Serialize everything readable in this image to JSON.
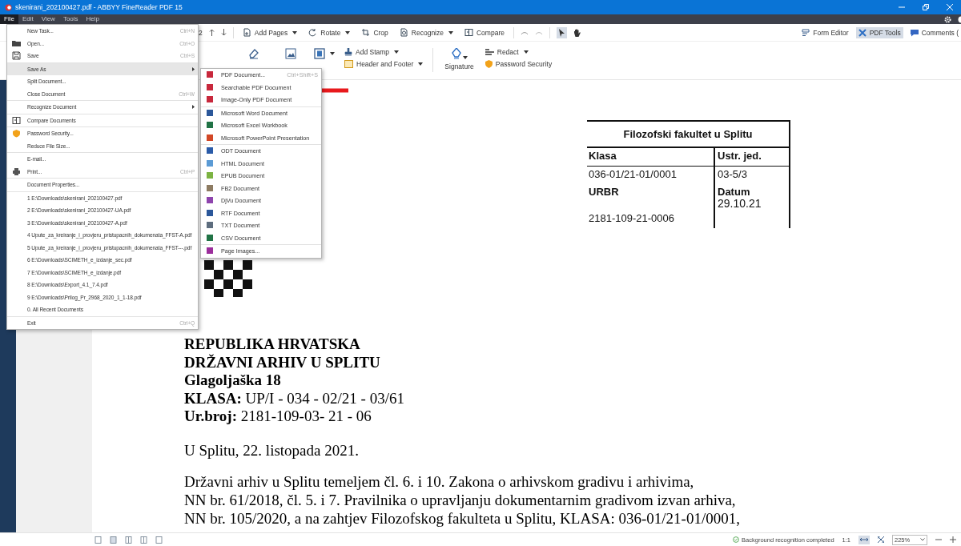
{
  "window": {
    "title": "skenirani_202100427.pdf - ABBYY FineReader PDF 15"
  },
  "menubar": [
    {
      "label": "File",
      "selected": true
    },
    {
      "label": "Edit",
      "selected": false
    },
    {
      "label": "View",
      "selected": false
    },
    {
      "label": "Tools",
      "selected": false
    },
    {
      "label": "Help",
      "selected": false
    }
  ],
  "toolbar": {
    "page_number": "2",
    "left_tools": [
      {
        "label": "Add Pages",
        "dropdown": true
      },
      {
        "label": "Rotate",
        "dropdown": true
      },
      {
        "label": "Crop",
        "dropdown": false
      },
      {
        "label": "Recognize",
        "dropdown": true
      },
      {
        "label": "Compare",
        "dropdown": false
      }
    ],
    "right_tools": [
      {
        "label": "Form Editor",
        "selected": false
      },
      {
        "label": "PDF Tools",
        "selected": true
      },
      {
        "label": "Comments (",
        "selected": false
      }
    ],
    "stamp_tools": [
      {
        "label": "Add Stamp",
        "dropdown": true
      },
      {
        "label": "Header and Footer",
        "dropdown": true
      }
    ],
    "signature": {
      "label": "Signature"
    },
    "security_tools": [
      {
        "label": "Redact",
        "dropdown": true
      },
      {
        "label": "Password Security",
        "dropdown": false
      }
    ]
  },
  "file_menu": {
    "groups": [
      {
        "items": [
          {
            "label": "New Task...",
            "shortcut": "Ctrl+N",
            "selected": false,
            "submenu": false
          },
          {
            "label": "Open...",
            "shortcut": "Ctrl+O",
            "selected": false,
            "submenu": false
          },
          {
            "label": "Save",
            "shortcut": "Ctrl+S",
            "selected": false,
            "submenu": false
          }
        ]
      },
      {
        "items": [
          {
            "label": "Save As",
            "selected": true,
            "submenu": true
          },
          {
            "label": "Split Document...",
            "selected": false,
            "submenu": false
          },
          {
            "label": "Close Document",
            "shortcut": "Ctrl+W",
            "selected": false,
            "submenu": false
          }
        ]
      },
      {
        "items": [
          {
            "label": "Recognize Document",
            "selected": false,
            "submenu": true
          }
        ]
      },
      {
        "items": [
          {
            "label": "Compare Documents",
            "selected": false,
            "submenu": false
          }
        ]
      },
      {
        "items": [
          {
            "label": "Password Security...",
            "selected": false,
            "submenu": false
          },
          {
            "label": "Reduce File Size...",
            "selected": false,
            "submenu": false
          }
        ]
      },
      {
        "items": [
          {
            "label": "E-mail...",
            "selected": false,
            "submenu": false
          },
          {
            "label": "Print...",
            "shortcut": "Ctrl+P",
            "selected": false,
            "submenu": false
          }
        ]
      },
      {
        "items": [
          {
            "label": "Document Properties...",
            "selected": false,
            "submenu": false
          }
        ]
      },
      {
        "items": [
          {
            "label": "1 E:\\Downloads\\skenirani_202100427.pdf",
            "selected": false,
            "submenu": false
          },
          {
            "label": "2 E:\\Downloads\\skenirani_202100427-UA.pdf",
            "selected": false,
            "submenu": false
          },
          {
            "label": "3 E:\\Downloads\\skenirani_202100427-A.pdf",
            "selected": false,
            "submenu": false
          },
          {
            "label": "4 Upute_za_kreiranje_i_provjeru_pristupacnih_dokumenata_FFST-A.pdf",
            "selected": false,
            "submenu": false
          },
          {
            "label": "5 Upute_za_kreiranje_i_provjeru_pristupacnih_dokumenata_FFST---.pdf",
            "selected": false,
            "submenu": false
          },
          {
            "label": "6 E:\\Downloads\\SCIMETH_e_izdanje_sec.pdf",
            "selected": false,
            "submenu": false
          },
          {
            "label": "7 E:\\Downloads\\SCIMETH_e_izdanje.pdf",
            "selected": false,
            "submenu": false
          },
          {
            "label": "8 E:\\Downloads\\Export_4.1_7.4.pdf",
            "selected": false,
            "submenu": false
          },
          {
            "label": "9 E:\\Downloads\\Prilog_Pr_2968_2020_1_1-18.pdf",
            "selected": false,
            "submenu": false
          },
          {
            "label": "0. All Recent Documents",
            "selected": false,
            "submenu": false
          }
        ]
      },
      {
        "items": [
          {
            "label": "Exit",
            "shortcut": "Ctrl+Q",
            "selected": false,
            "submenu": false
          }
        ]
      }
    ]
  },
  "save_as_menu": {
    "groups": [
      {
        "items": [
          {
            "label": "PDF Document...",
            "shortcut": "Ctrl+Shift+S",
            "color": "#c8283c"
          },
          {
            "label": "Searchable PDF Document",
            "color": "#c8283c"
          },
          {
            "label": "Image-Only PDF Document",
            "color": "#c8283c"
          }
        ]
      },
      {
        "items": [
          {
            "label": "Microsoft Word Document",
            "color": "#2b579a"
          },
          {
            "label": "Microsoft Excel Workbook",
            "color": "#217346"
          },
          {
            "label": "Microsoft PowerPoint Presentation",
            "color": "#d24726"
          }
        ]
      },
      {
        "items": [
          {
            "label": "ODT Document",
            "color": "#2a5ba8"
          },
          {
            "label": "HTML Document",
            "color": "#5b9bd5"
          },
          {
            "label": "EPUB Document",
            "color": "#7cb342"
          },
          {
            "label": "FB2 Document",
            "color": "#8d7b62"
          },
          {
            "label": "DjVu Document",
            "color": "#8e44ad"
          },
          {
            "label": "RTF Document",
            "color": "#2b579a"
          },
          {
            "label": "TXT Document",
            "color": "#5d6d7e"
          },
          {
            "label": "CSV Document",
            "color": "#217346"
          }
        ]
      },
      {
        "items": [
          {
            "label": "Page Images...",
            "color": "#9b2d9b"
          }
        ]
      }
    ]
  },
  "document": {
    "stamp": {
      "title": "Filozofski fakultet u Splitu",
      "rows": [
        [
          {
            "text": "Klasa",
            "bold": true
          },
          {
            "text": "Ustr. jed.",
            "bold": true
          }
        ],
        [
          {
            "text": "036-01/21-01/0001",
            "bold": false
          },
          {
            "text": "03-5/3",
            "bold": false
          }
        ],
        [
          {
            "text": "URBR",
            "bold": true
          },
          {
            "text": "Datum",
            "bold": true,
            "extra": "29.10.21"
          }
        ],
        [
          {
            "text": "2181-109-21-0006",
            "bold": false
          }
        ]
      ]
    },
    "header_lines": [
      "REPUBLIKA HRVATSKA",
      "DRŽAVNI ARHIV U SPLITU",
      "Glagoljaška 18",
      "**KLASA:** UP/I - 034 - 02/21 - 03/61",
      "**Ur.broj:** 2181-109-03- 21 - 06"
    ],
    "date_line": "U Splitu, 22. listopada 2021.",
    "body_lines": [
      "Državni arhiv u Splitu temeljem čl. 6. i 10. Zakona o arhivskom gradivu i arhivima,",
      "NN br. 61/2018,  čl. 5. i  7. Pravilnika o upravljanju dokumentarnim gradivom izvan arhiva,",
      "NN br. 105/2020, a na zahtjev Filozofskog fakulteta u Splitu, KLASA: 036-01/21-01/0001,"
    ]
  },
  "status_bar": {
    "message": "Background recognition completed",
    "actual_size": "1:1",
    "zoom": "225%"
  }
}
